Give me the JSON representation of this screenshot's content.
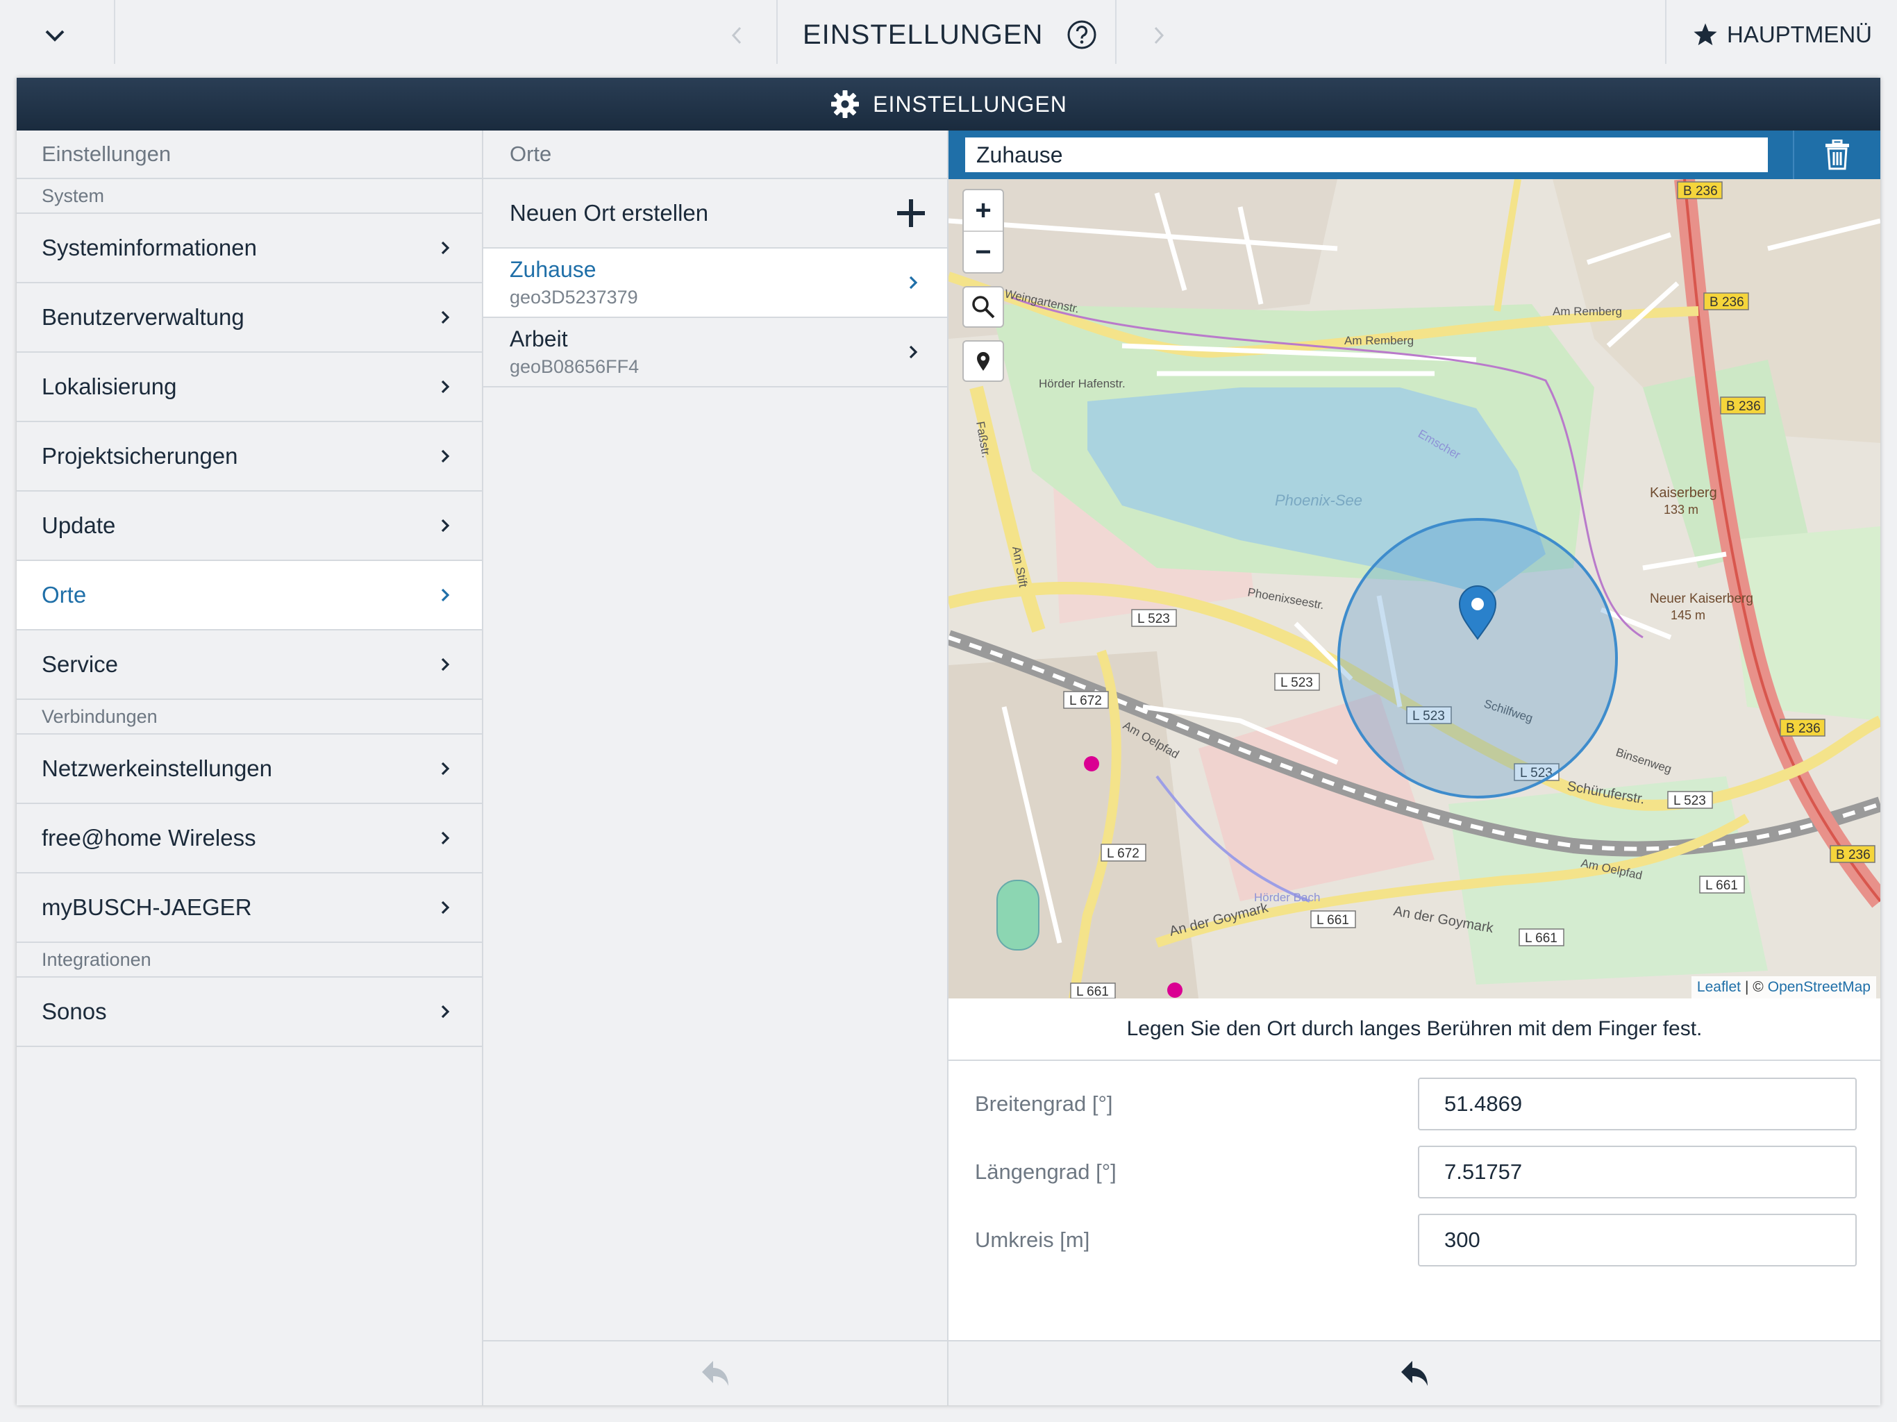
{
  "topbar": {
    "title": "EINSTELLUNGEN",
    "main_menu_label": "HAUPTMENÜ"
  },
  "window": {
    "title": "EINSTELLUNGEN"
  },
  "sidebar": {
    "header": "Einstellungen",
    "sections": [
      {
        "label": "System"
      },
      {
        "label": "Verbindungen"
      },
      {
        "label": "Integrationen"
      }
    ],
    "items": [
      {
        "label": "Systeminformationen"
      },
      {
        "label": "Benutzerverwaltung"
      },
      {
        "label": "Lokalisierung"
      },
      {
        "label": "Projektsicherungen"
      },
      {
        "label": "Update"
      },
      {
        "label": "Orte",
        "active": true
      },
      {
        "label": "Service"
      },
      {
        "label": "Netzwerkeinstellungen"
      },
      {
        "label": "free@home Wireless"
      },
      {
        "label": "myBUSCH-JAEGER"
      },
      {
        "label": "Sonos"
      }
    ]
  },
  "places": {
    "header": "Orte",
    "create_label": "Neuen Ort erstellen",
    "items": [
      {
        "name": "Zuhause",
        "id": "geo3D5237379",
        "active": true
      },
      {
        "name": "Arbeit",
        "id": "geoB08656FF4"
      }
    ]
  },
  "detail": {
    "name": "Zuhause",
    "hint": "Legen Sie den Ort durch langes Berühren mit dem Finger fest.",
    "fields": [
      {
        "label": "Breitengrad [°]",
        "value": "51.4869"
      },
      {
        "label": "Längengrad [°]",
        "value": "7.51757"
      },
      {
        "label": "Umkreis [m]",
        "value": "300"
      }
    ]
  },
  "map": {
    "zoom_in": "+",
    "zoom_out": "−",
    "attribution_leaflet": "Leaflet",
    "attribution_sep": "| ©",
    "attribution_osm": "OpenStreetMap",
    "labels": {
      "lake": "Phoenix-See",
      "kaiserberg": "Kaiserberg",
      "kaiserberg_alt": "133 m",
      "neuer_kaiserberg": "Neuer Kaiserberg",
      "neuer_kaiserberg_alt": "145 m",
      "am_remberg": "Am Remberg",
      "weingartenstr": "Weingartenstr.",
      "phoenixseestr": "Phoenixseestr.",
      "fasstr": "Faßstr.",
      "am_stift": "Am Stift",
      "hoerder_hafenstr": "Hörder Hafenstr.",
      "am_oelpfad": "Am Oelpfad",
      "an_der_goymark": "An der Goymark",
      "schuerufer": "Schüruferstr.",
      "schilfweg": "Schilfweg",
      "binsenweg": "Binsenweg",
      "hoerder_bach": "Hörder Bach",
      "emscher": "Emscher",
      "b236": "B 236",
      "l523": "L 523",
      "l672": "L 672",
      "l661": "L 661"
    }
  },
  "colors": {
    "accent": "#1f6fa8",
    "header_dark": "#1a2b3e",
    "background": "#f0f1f3",
    "map_radius": "#3e8ccc"
  }
}
